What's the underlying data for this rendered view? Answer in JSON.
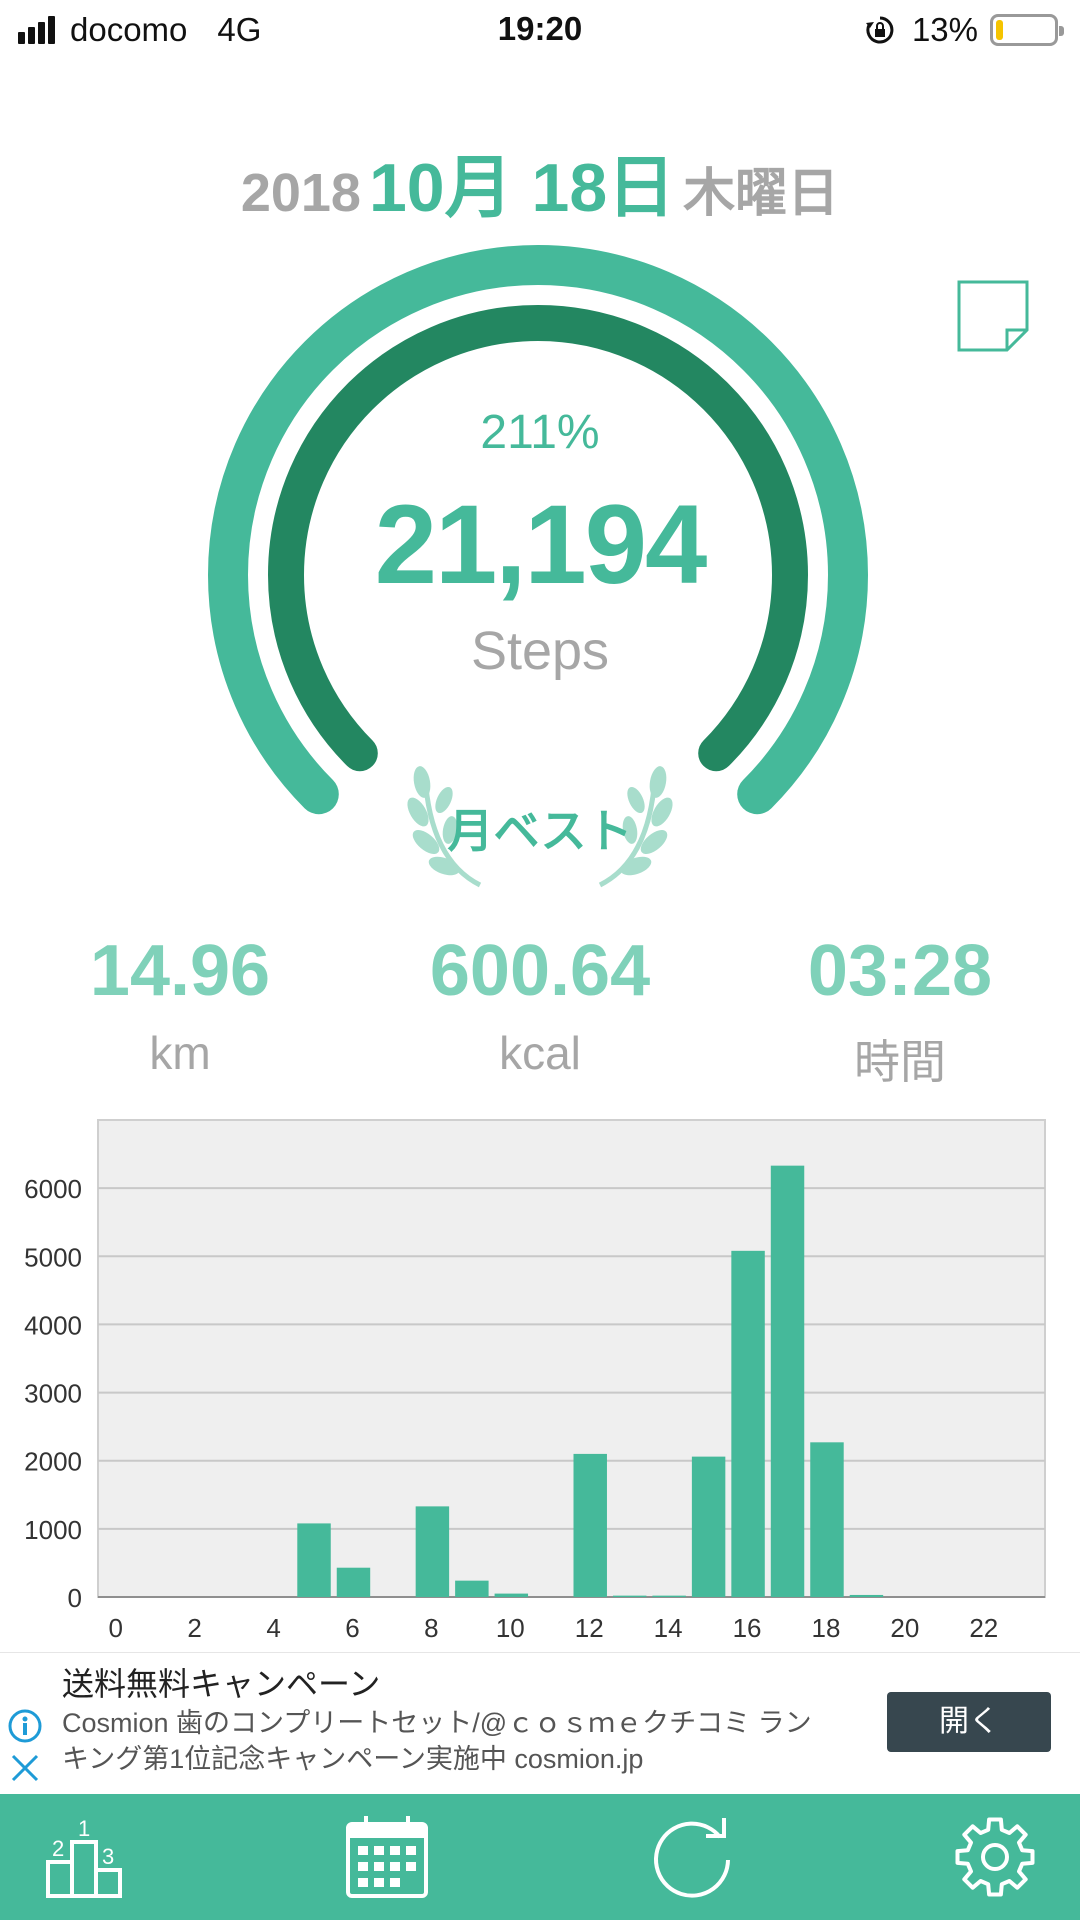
{
  "status": {
    "carrier": "docomo",
    "network": "4G",
    "time": "19:20",
    "battery_percent": "13%",
    "battery_level": 0.13,
    "battery_color": "#f5c400"
  },
  "date": {
    "year": "2018",
    "month_day": "10月 18日",
    "weekday": "木曜日"
  },
  "gauge": {
    "percent_text": "211%",
    "steps": "21,194",
    "unit": "Steps",
    "badge": "月ベスト",
    "progress": 2.11
  },
  "stats": [
    {
      "value": "14.96",
      "label": "km"
    },
    {
      "value": "600.64",
      "label": "kcal"
    },
    {
      "value": "03:28",
      "label": "時間"
    }
  ],
  "chart_data": {
    "type": "bar",
    "x": [
      0,
      1,
      2,
      3,
      4,
      5,
      6,
      7,
      8,
      9,
      10,
      11,
      12,
      13,
      14,
      15,
      16,
      17,
      18,
      19,
      20,
      21,
      22,
      23
    ],
    "values": [
      0,
      0,
      0,
      0,
      0,
      1080,
      430,
      0,
      1330,
      240,
      50,
      0,
      2100,
      20,
      20,
      2060,
      5080,
      6330,
      2270,
      30,
      0,
      0,
      0,
      0
    ],
    "x_tick_labels": [
      "0",
      "2",
      "4",
      "6",
      "8",
      "10",
      "12",
      "14",
      "16",
      "18",
      "20",
      "22"
    ],
    "y_tick_labels": [
      "0",
      "1000",
      "2000",
      "3000",
      "4000",
      "5000",
      "6000"
    ],
    "ylim": [
      0,
      7000
    ],
    "grid": true,
    "bar_color": "#45b99a",
    "background_color": "#efefef"
  },
  "ad": {
    "title": "送料無料キャンペーン",
    "line1": "Cosmion 歯のコンプリートセット/@ｃｏｓｍｅクチコミ ラン",
    "line2": "キング第1位記念キャンペーン実施中 cosmion.jp",
    "button": "開く"
  },
  "tabs": [
    {
      "icon": "ranking-podium-icon"
    },
    {
      "icon": "calendar-icon"
    },
    {
      "icon": "refresh-icon"
    },
    {
      "icon": "settings-gear-icon"
    }
  ],
  "colors": {
    "accent": "#45b99a",
    "accent_dark": "#238761",
    "accent_light": "#7fd1b9",
    "muted_text": "#a6a6a6"
  }
}
